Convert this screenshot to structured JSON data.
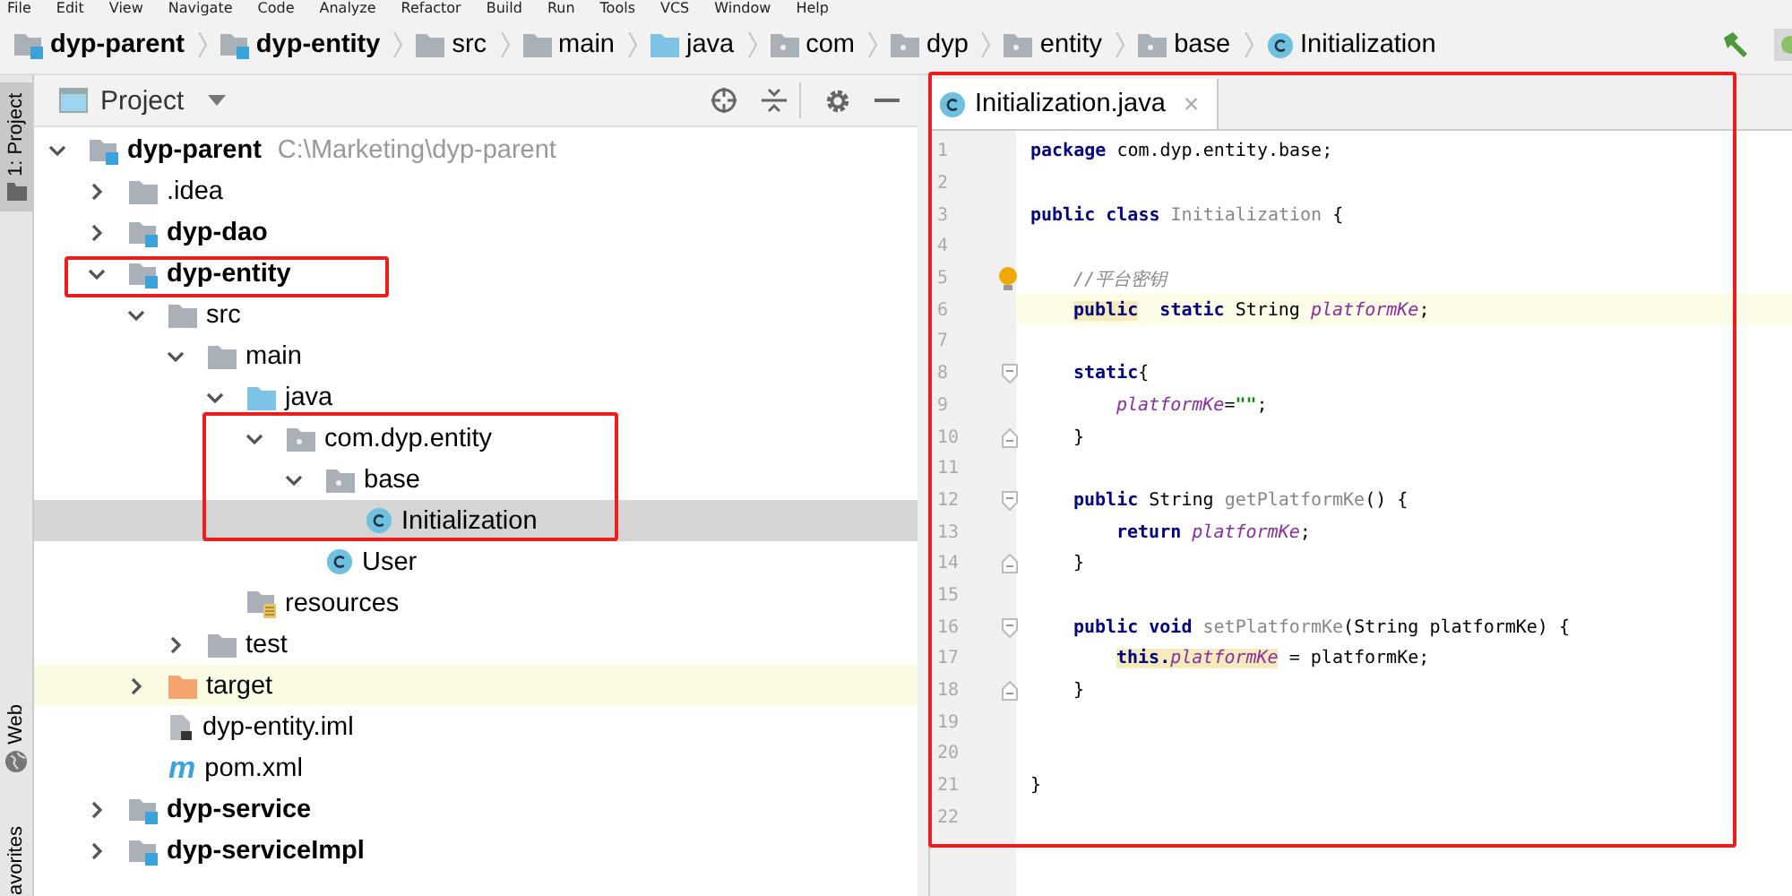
{
  "menu": [
    "File",
    "Edit",
    "View",
    "Navigate",
    "Code",
    "Analyze",
    "Refactor",
    "Build",
    "Run",
    "Tools",
    "VCS",
    "Window",
    "Help"
  ],
  "breadcrumbs": [
    {
      "label": "dyp-parent",
      "kind": "module"
    },
    {
      "label": "dyp-entity",
      "kind": "module"
    },
    {
      "label": "src",
      "kind": "folder"
    },
    {
      "label": "main",
      "kind": "folder"
    },
    {
      "label": "java",
      "kind": "source-folder"
    },
    {
      "label": "com",
      "kind": "package"
    },
    {
      "label": "dyp",
      "kind": "package"
    },
    {
      "label": "entity",
      "kind": "package"
    },
    {
      "label": "base",
      "kind": "package"
    },
    {
      "label": "Initialization",
      "kind": "class"
    }
  ],
  "tool_stripe": [
    {
      "label": "1: Project",
      "kind": "project",
      "selected": true
    },
    {
      "label": "Web",
      "kind": "web",
      "selected": false
    },
    {
      "label": "avorites",
      "kind": "favorites",
      "selected": false
    }
  ],
  "project_panel": {
    "title": "Project"
  },
  "tree": [
    {
      "label": "dyp-parent",
      "path": "C:\\Marketing\\dyp-parent",
      "kind": "module",
      "expanded": true,
      "selected": false,
      "children": [
        {
          "label": ".idea",
          "kind": "folder",
          "expanded": false,
          "selected": false
        },
        {
          "label": "dyp-dao",
          "kind": "module",
          "expanded": false,
          "selected": false
        },
        {
          "label": "dyp-entity",
          "kind": "module",
          "expanded": true,
          "selected": false,
          "children": [
            {
              "label": "src",
              "kind": "folder",
              "expanded": true,
              "selected": false,
              "children": [
                {
                  "label": "main",
                  "kind": "folder",
                  "expanded": true,
                  "selected": false,
                  "children": [
                    {
                      "label": "java",
                      "kind": "source-folder",
                      "expanded": true,
                      "selected": false,
                      "children": [
                        {
                          "label": "com.dyp.entity",
                          "kind": "package",
                          "expanded": true,
                          "selected": false,
                          "children": [
                            {
                              "label": "base",
                              "kind": "package",
                              "expanded": true,
                              "selected": false,
                              "children": [
                                {
                                  "label": "Initialization",
                                  "kind": "class",
                                  "selected": true
                                }
                              ]
                            },
                            {
                              "label": "User",
                              "kind": "class",
                              "selected": false
                            }
                          ]
                        }
                      ]
                    },
                    {
                      "label": "resources",
                      "kind": "resources",
                      "selected": false
                    }
                  ]
                },
                {
                  "label": "test",
                  "kind": "folder",
                  "expanded": false,
                  "selected": false
                }
              ]
            },
            {
              "label": "target",
              "kind": "target",
              "expanded": false,
              "selected": false
            },
            {
              "label": "dyp-entity.iml",
              "kind": "iml",
              "selected": false
            },
            {
              "label": "pom.xml",
              "kind": "pom",
              "badge": "m",
              "selected": false
            }
          ]
        },
        {
          "label": "dyp-service",
          "kind": "module",
          "expanded": false,
          "selected": false
        },
        {
          "label": "dyp-serviceImpl",
          "kind": "module",
          "expanded": false,
          "selected": false
        }
      ]
    }
  ],
  "editor_tab": {
    "label": "Initialization.java",
    "close": "×"
  },
  "code": [
    {
      "n": "1",
      "current": false,
      "tokens": [
        {
          "t": "package",
          "kind": "kw"
        },
        {
          "t": "com.dyp.entity.base;",
          "kind": "text"
        }
      ]
    },
    {
      "n": "2",
      "current": false
    },
    {
      "n": "3",
      "current": false,
      "tokens": [
        {
          "t": "public class",
          "kind": "kw"
        },
        {
          "t": "Initialization",
          "kind": "decl"
        },
        {
          "t": "{",
          "kind": "text"
        }
      ]
    },
    {
      "n": "4",
      "current": false
    },
    {
      "n": "5",
      "current": false,
      "kind": "bulb",
      "tokens": [
        {
          "t": "//平台密钥",
          "kind": "comment"
        }
      ]
    },
    {
      "n": "6",
      "current": true,
      "tokens": [
        {
          "t": "public",
          "kind": "kw-marked"
        },
        {
          "t": "static",
          "kind": "kw"
        },
        {
          "t": "String",
          "kind": "text"
        },
        {
          "t": "platformKe",
          "kind": "field"
        },
        {
          "t": ";",
          "kind": "text"
        }
      ]
    },
    {
      "n": "7",
      "current": false
    },
    {
      "n": "8",
      "current": false,
      "kind": "fold-start",
      "tokens": [
        {
          "t": "static",
          "kind": "kw"
        },
        {
          "t": "{",
          "kind": "text"
        }
      ]
    },
    {
      "n": "9",
      "current": false,
      "tokens": [
        {
          "t": "platformKe",
          "kind": "field"
        },
        {
          "t": "=",
          "kind": "text"
        },
        {
          "t": "\"\"",
          "kind": "string"
        },
        {
          "t": ";",
          "kind": "text"
        }
      ]
    },
    {
      "n": "10",
      "current": false,
      "kind": "fold-end",
      "tokens": [
        {
          "t": "}",
          "kind": "text"
        }
      ]
    },
    {
      "n": "11",
      "current": false
    },
    {
      "n": "12",
      "current": false,
      "kind": "fold-start",
      "tokens": [
        {
          "t": "public",
          "kind": "kw"
        },
        {
          "t": "String",
          "kind": "text"
        },
        {
          "t": "getPlatformKe",
          "kind": "decl"
        },
        {
          "t": "() {",
          "kind": "text"
        }
      ]
    },
    {
      "n": "13",
      "current": false,
      "tokens": [
        {
          "t": "return",
          "kind": "kw"
        },
        {
          "t": "platformKe",
          "kind": "field"
        },
        {
          "t": ";",
          "kind": "text"
        }
      ]
    },
    {
      "n": "14",
      "current": false,
      "kind": "fold-end",
      "tokens": [
        {
          "t": "}",
          "kind": "text"
        }
      ]
    },
    {
      "n": "15",
      "current": false
    },
    {
      "n": "16",
      "current": false,
      "kind": "fold-start",
      "tokens": [
        {
          "t": "public void",
          "kind": "kw"
        },
        {
          "t": "setPlatformKe",
          "kind": "decl"
        },
        {
          "t": "(String platformKe) {",
          "kind": "text"
        }
      ]
    },
    {
      "n": "17",
      "current": false,
      "tokens": [
        {
          "t": "this.",
          "kind": "kw-marked"
        },
        {
          "t": "platformKe",
          "kind": "field-marked"
        },
        {
          "t": "= platformKe;",
          "kind": "text"
        }
      ]
    },
    {
      "n": "18",
      "current": false,
      "kind": "fold-end",
      "tokens": [
        {
          "t": "}",
          "kind": "text"
        }
      ]
    },
    {
      "n": "19",
      "current": false
    },
    {
      "n": "20",
      "current": false
    },
    {
      "n": "21",
      "current": false,
      "tokens": [
        {
          "t": "}",
          "kind": "text"
        }
      ]
    },
    {
      "n": "22",
      "current": false
    }
  ]
}
